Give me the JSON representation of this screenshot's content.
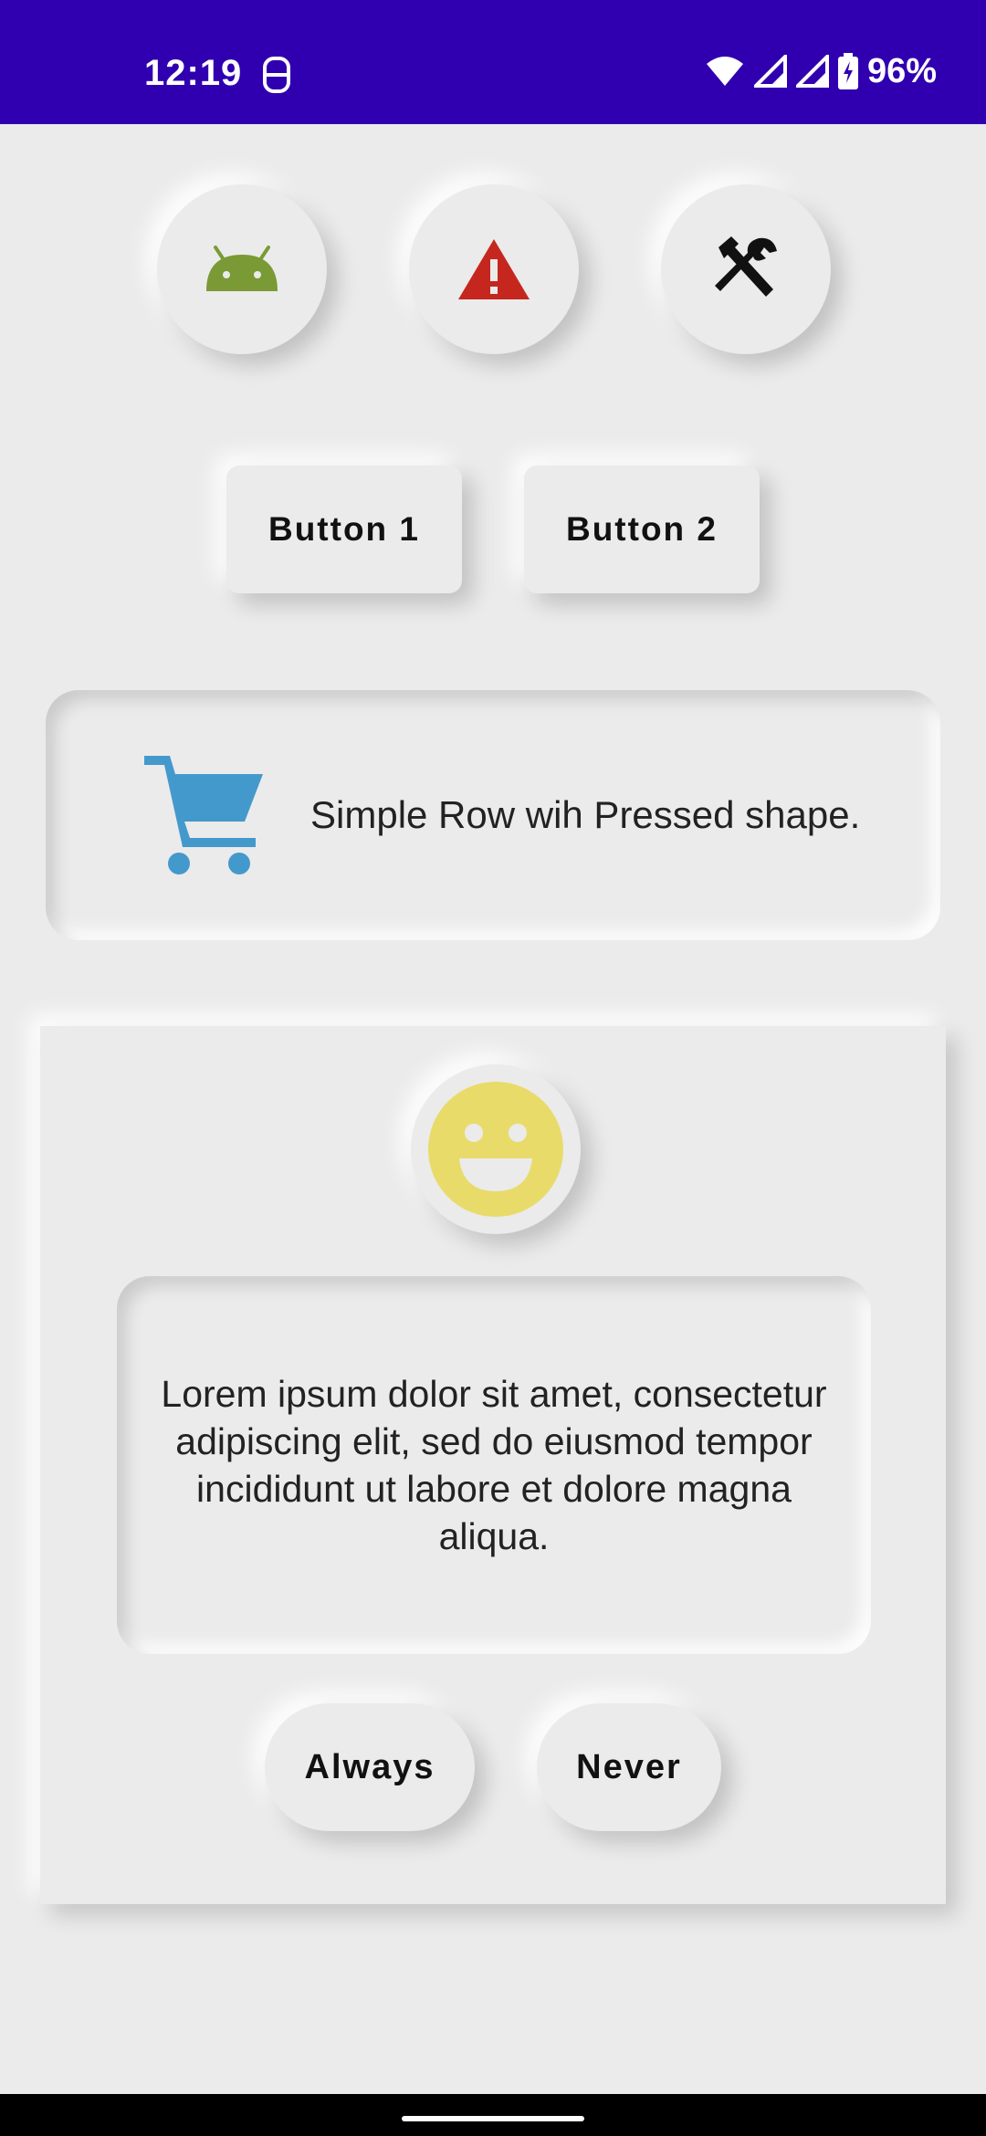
{
  "status_bar": {
    "time": "12:19",
    "battery": "96%",
    "icons": [
      "notification-icon",
      "wifi-icon",
      "signal-icon",
      "signal-icon",
      "battery-charging-icon"
    ]
  },
  "icon_buttons": [
    {
      "icon": "android-icon",
      "color": "#7a9a35"
    },
    {
      "icon": "warning-icon",
      "color": "#c5271e"
    },
    {
      "icon": "tools-icon",
      "color": "#111111"
    }
  ],
  "buttons": {
    "button1": "Button 1",
    "button2": "Button 2"
  },
  "pressed_row": {
    "icon": "cart-icon",
    "icon_color": "#4499cc",
    "text": "Simple Row wih Pressed shape."
  },
  "card": {
    "icon": "smiley-icon",
    "icon_color": "#e9db6a",
    "text": "Lorem ipsum dolor sit amet, consectetur adipiscing elit, sed do eiusmod tempor incididunt ut labore et dolore magna aliqua.",
    "always_label": "Always",
    "never_label": "Never"
  },
  "colors": {
    "status_bar": "#3000b0",
    "background": "#ebebeb"
  }
}
